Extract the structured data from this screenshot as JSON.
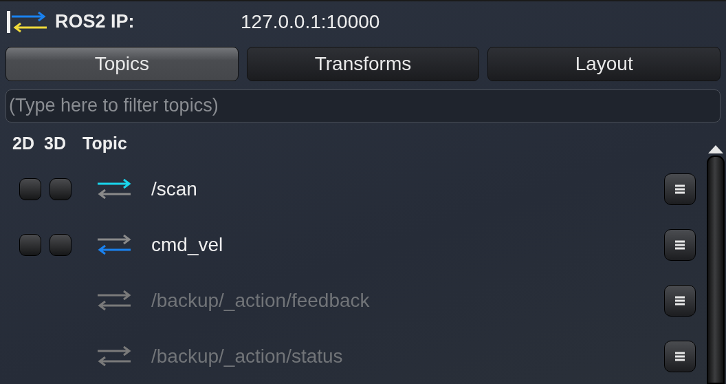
{
  "header": {
    "label": "ROS2 IP:",
    "value": "127.0.0.1:10000"
  },
  "tabs": [
    {
      "label": "Topics",
      "selected": true
    },
    {
      "label": "Transforms",
      "selected": false
    },
    {
      "label": "Layout",
      "selected": false
    }
  ],
  "filter": {
    "placeholder": "(Type here to filter topics)"
  },
  "columns": [
    "2D",
    "3D",
    "Topic"
  ],
  "topics": [
    {
      "name": "/scan",
      "kind": "outgoing",
      "show_2d": false,
      "show_3d": false
    },
    {
      "name": "cmd_vel",
      "kind": "incoming",
      "show_2d": false,
      "show_3d": false
    },
    {
      "name": "/backup/_action/feedback",
      "kind": "unavailable"
    },
    {
      "name": "/backup/_action/status",
      "kind": "unavailable"
    }
  ]
}
